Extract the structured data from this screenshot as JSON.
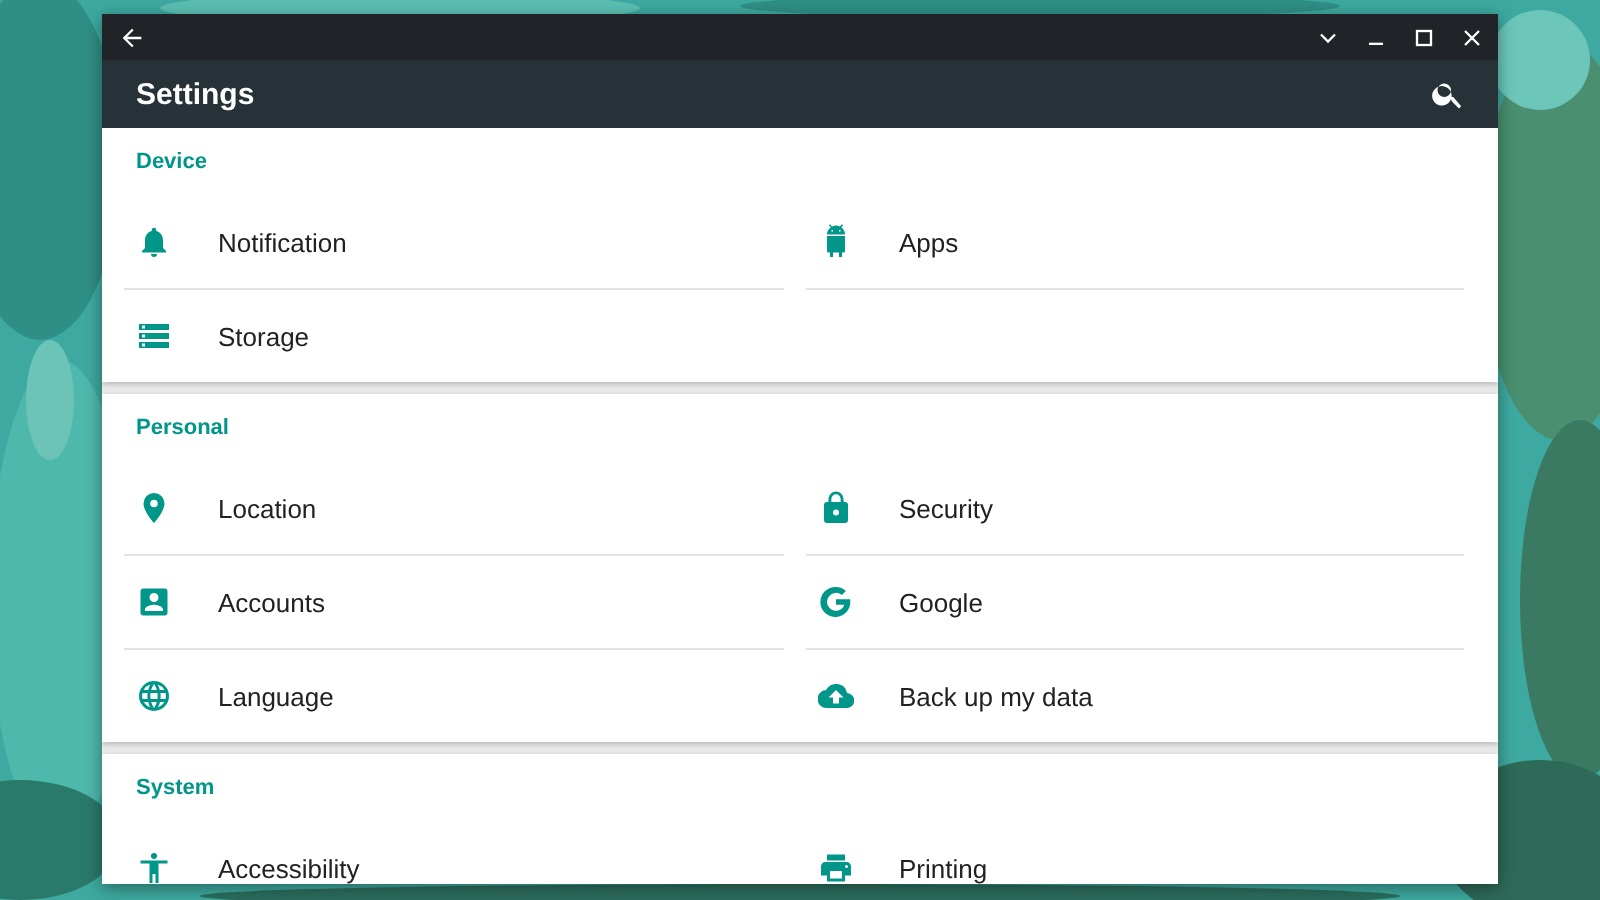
{
  "window": {
    "title": "Settings"
  },
  "sections": [
    {
      "title": "Device",
      "items": [
        {
          "label": "Notification"
        },
        {
          "label": "Apps"
        },
        {
          "label": "Storage"
        }
      ]
    },
    {
      "title": "Personal",
      "items": [
        {
          "label": "Location"
        },
        {
          "label": "Security"
        },
        {
          "label": "Accounts"
        },
        {
          "label": "Google"
        },
        {
          "label": "Language"
        },
        {
          "label": "Back up my data"
        }
      ]
    },
    {
      "title": "System",
      "items": [
        {
          "label": "Accessibility"
        },
        {
          "label": "Printing"
        }
      ]
    }
  ]
}
